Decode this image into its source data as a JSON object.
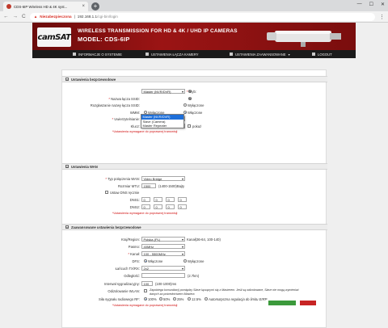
{
  "browser": {
    "tab_title": "CDS-6IP Wireless HD & 4K syst...",
    "tab_close": "×",
    "new_tab": "+",
    "window_buttons": [
      "—",
      "☐",
      "✕"
    ],
    "nav": {
      "back": "←",
      "forward": "→",
      "reload": "C"
    },
    "url_warning": "Niezabezpieczona",
    "url_host": "192.168.1.1",
    "url_path": "/cgi-bin/login",
    "menu": "⋮"
  },
  "banner": {
    "logo": "camSAT",
    "line1": "WIRELESS TRANSMISSION FOR HD & 4K / UHD IP CAMERAS",
    "line2": "MODEL: CDS-6IP"
  },
  "nav": {
    "items": [
      {
        "label": "INFORMACJE O SYSTEMIE"
      },
      {
        "label": "USTAWIENIA ŁĄCZA KAMERY"
      },
      {
        "label": "USTAWIENIA ZAAWANSOWANE"
      },
      {
        "label": "LOGOUT"
      }
    ],
    "advanced_caret": "▾"
  },
  "wireless": {
    "section_title": "Ustawienia bezprzewodowe",
    "collapse_icon": "−",
    "tryb_label": "Tryb:",
    "tryb_value": "Master (NVR/DVR)",
    "tryb_options": [
      "Master (NVR/DVR)",
      "Slave (Camera)",
      "Master Repeater"
    ],
    "ssid_label": "Nazwa łącza SSID:",
    "hide_ssid_label": "Rozgłaszanie nazwy łącza SSID:",
    "hide_ssid_right": "Wyłączone",
    "wmm_label": "WMM:",
    "wmm_off": "Wyłączone",
    "wmm_on": "Włączone",
    "auth_label": "Uwierzytelnianie:",
    "auth_value": "WPA2-PSK",
    "key_label": "Klucz:",
    "key_value": "••••••••••",
    "show_label": "pokaż",
    "required_note": "*Ustawienia wymagane do poprawnej transmisji"
  },
  "wan": {
    "section_title": "Ustawienia WAN",
    "collapse_icon": "−",
    "type_label": "Typ połączenia WAN:",
    "type_value": "Video Bridge",
    "mtu_label": "Rozmiar MTU:",
    "mtu_value": "1500",
    "mtu_hint": "(1400-1500)Bajty",
    "dns_label": "Ustaw DNS ręcznie",
    "dns1_label": "DNS1:",
    "dns2_label": "DNS2:",
    "dns_octets": [
      "0",
      "0",
      "0",
      "0"
    ],
    "required_note": "*Ustawienia wymagane do poprawnej transmisji"
  },
  "advanced": {
    "section_title": "Zaawansowane ustawienia bezprzewodowe",
    "collapse_icon": "−",
    "region_label": "Kraj/Region:",
    "region_value": "Polska (PL)",
    "region_hint": "Kanał(36-64, 100-140)",
    "band_label": "Pasmo:",
    "band_value": "40MHz",
    "channel_label": "Kanał:",
    "channel_value": "100 - 5500MHz",
    "dfs_label": "DFS:",
    "dfs_on": "Włączone",
    "dfs_off": "Wyłączone",
    "txrx_label": "Łańcuch TX/RX:",
    "txrx_value": "2x2",
    "distance_label": "Odległość:",
    "distance_hint": "(2.7km)",
    "beacon_label": "Interwał sygnalizacyjny:",
    "beacon_value": "100",
    "beacon_hint": "(100-1000)ms",
    "isolation_label": "Odizolowanie WLAN:",
    "isolation_text": "Zapobiega komunikacji pomiędzy Slave łączącymi się z Masterem. Jeśli są odizolowane, Slave nie mogą wymieniać danych za pośrednictwem Mastera",
    "power_label": "Siła sygnału radiowego RF:",
    "power_options": [
      "100%",
      "50%",
      "25%",
      "12.5%",
      "Automatyczna regulacja do limitu EIRP"
    ],
    "required_note": "*Ustawienia wymagane do poprawnej transmisji"
  },
  "colors": {
    "accent": "#9b1414",
    "nav_bg": "#1b1b1b",
    "required": "#d01010",
    "save": "#3c9a3c",
    "cancel": "#c72424"
  }
}
